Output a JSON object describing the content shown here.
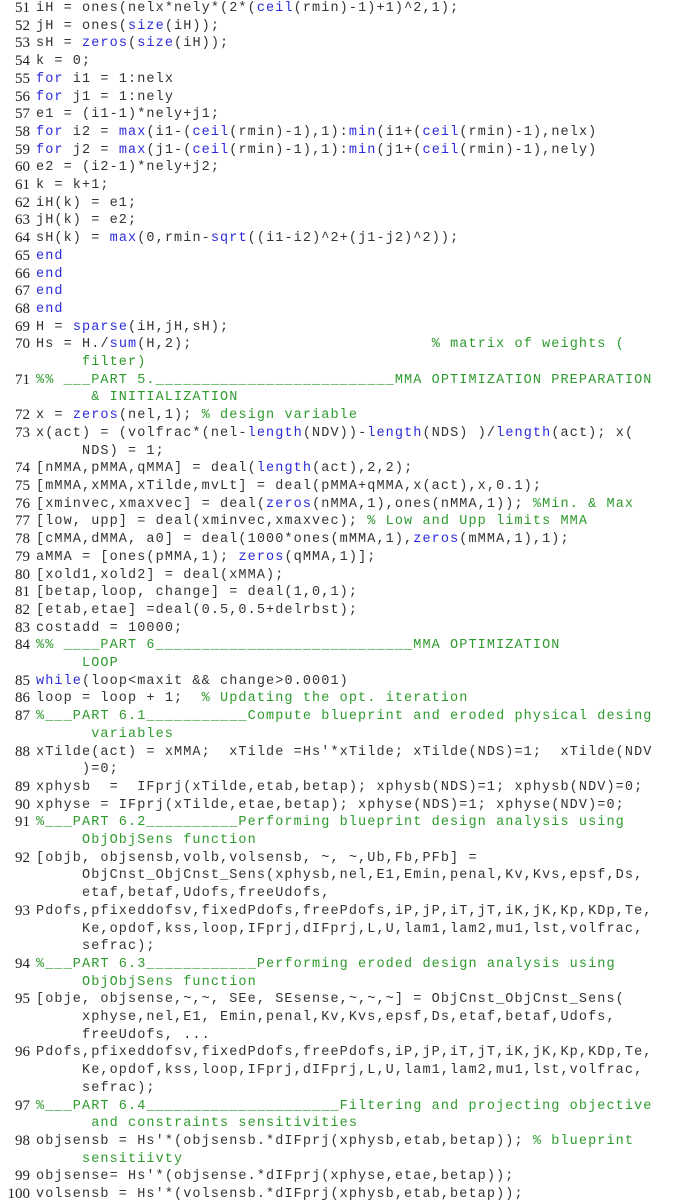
{
  "colors": {
    "keyword": "#2b2bdb",
    "comment": "#2e9a2e",
    "text": "#333333",
    "line_number": "#222222"
  },
  "lines": [
    {
      "n": "51",
      "segs": [
        [
          "t",
          "iH = ones(nelx*nely*(2*("
        ],
        [
          "k",
          "ceil"
        ],
        [
          "t",
          "(rmin)-1)+1)^2,1);"
        ]
      ]
    },
    {
      "n": "52",
      "segs": [
        [
          "t",
          "jH = ones("
        ],
        [
          "k",
          "size"
        ],
        [
          "t",
          "(iH));"
        ]
      ]
    },
    {
      "n": "53",
      "segs": [
        [
          "t",
          "sH = "
        ],
        [
          "k",
          "zeros"
        ],
        [
          "t",
          "("
        ],
        [
          "k",
          "size"
        ],
        [
          "t",
          "(iH));"
        ]
      ]
    },
    {
      "n": "54",
      "segs": [
        [
          "t",
          "k = 0;"
        ]
      ]
    },
    {
      "n": "55",
      "segs": [
        [
          "k",
          "for"
        ],
        [
          "t",
          " i1 = 1:nelx"
        ]
      ]
    },
    {
      "n": "56",
      "segs": [
        [
          "k",
          "for"
        ],
        [
          "t",
          " j1 = 1:nely"
        ]
      ]
    },
    {
      "n": "57",
      "segs": [
        [
          "t",
          "e1 = (i1-1)*nely+j1;"
        ]
      ]
    },
    {
      "n": "58",
      "segs": [
        [
          "k",
          "for"
        ],
        [
          "t",
          " i2 = "
        ],
        [
          "k",
          "max"
        ],
        [
          "t",
          "(i1-("
        ],
        [
          "k",
          "ceil"
        ],
        [
          "t",
          "(rmin)-1),1):"
        ],
        [
          "k",
          "min"
        ],
        [
          "t",
          "(i1+("
        ],
        [
          "k",
          "ceil"
        ],
        [
          "t",
          "(rmin)-1),nelx)"
        ]
      ]
    },
    {
      "n": "59",
      "segs": [
        [
          "k",
          "for"
        ],
        [
          "t",
          " j2 = "
        ],
        [
          "k",
          "max"
        ],
        [
          "t",
          "(j1-("
        ],
        [
          "k",
          "ceil"
        ],
        [
          "t",
          "(rmin)-1),1):"
        ],
        [
          "k",
          "min"
        ],
        [
          "t",
          "(j1+("
        ],
        [
          "k",
          "ceil"
        ],
        [
          "t",
          "(rmin)-1),nely)"
        ]
      ]
    },
    {
      "n": "60",
      "segs": [
        [
          "t",
          "e2 = (i2-1)*nely+j2;"
        ]
      ]
    },
    {
      "n": "61",
      "segs": [
        [
          "t",
          "k = k+1;"
        ]
      ]
    },
    {
      "n": "62",
      "segs": [
        [
          "t",
          "iH(k) = e1;"
        ]
      ]
    },
    {
      "n": "63",
      "segs": [
        [
          "t",
          "jH(k) = e2;"
        ]
      ]
    },
    {
      "n": "64",
      "segs": [
        [
          "t",
          "sH(k) = "
        ],
        [
          "k",
          "max"
        ],
        [
          "t",
          "(0,rmin-"
        ],
        [
          "k",
          "sqrt"
        ],
        [
          "t",
          "((i1-i2)^2+(j1-j2)^2));"
        ]
      ]
    },
    {
      "n": "65",
      "segs": [
        [
          "k",
          "end"
        ]
      ]
    },
    {
      "n": "66",
      "segs": [
        [
          "k",
          "end"
        ]
      ]
    },
    {
      "n": "67",
      "segs": [
        [
          "k",
          "end"
        ]
      ]
    },
    {
      "n": "68",
      "segs": [
        [
          "k",
          "end"
        ]
      ]
    },
    {
      "n": "69",
      "segs": [
        [
          "t",
          "H = "
        ],
        [
          "k",
          "sparse"
        ],
        [
          "t",
          "(iH,jH,sH);"
        ]
      ]
    },
    {
      "n": "70",
      "segs": [
        [
          "t",
          "Hs = H./"
        ],
        [
          "k",
          "sum"
        ],
        [
          "t",
          "(H,2);                          "
        ],
        [
          "c",
          "% matrix of weights ("
        ]
      ]
    },
    {
      "n": "",
      "segs": [
        [
          "c",
          "filter)"
        ]
      ]
    },
    {
      "n": "71",
      "segs": [
        [
          "c",
          "%% ___PART 5.__________________________MMA OPTIMIZATION PREPARATION"
        ]
      ]
    },
    {
      "n": "",
      "segs": [
        [
          "c",
          " & INITIALIZATION"
        ]
      ]
    },
    {
      "n": "72",
      "segs": [
        [
          "t",
          "x = "
        ],
        [
          "k",
          "zeros"
        ],
        [
          "t",
          "(nel,1); "
        ],
        [
          "c",
          "% design variable"
        ]
      ]
    },
    {
      "n": "73",
      "segs": [
        [
          "t",
          "x(act) = (volfrac*(nel-"
        ],
        [
          "k",
          "length"
        ],
        [
          "t",
          "(NDV))-"
        ],
        [
          "k",
          "length"
        ],
        [
          "t",
          "(NDS) )/"
        ],
        [
          "k",
          "length"
        ],
        [
          "t",
          "(act); x("
        ]
      ]
    },
    {
      "n": "",
      "segs": [
        [
          "t",
          "NDS) = 1;"
        ]
      ]
    },
    {
      "n": "74",
      "segs": [
        [
          "t",
          "[nMMA,pMMA,qMMA] = deal("
        ],
        [
          "k",
          "length"
        ],
        [
          "t",
          "(act),2,2);"
        ]
      ]
    },
    {
      "n": "75",
      "segs": [
        [
          "t",
          "[mMMA,xMMA,xTilde,mvLt] = deal(pMMA+qMMA,x(act),x,0.1);"
        ]
      ]
    },
    {
      "n": "76",
      "segs": [
        [
          "t",
          "[xminvec,xmaxvec] = deal("
        ],
        [
          "k",
          "zeros"
        ],
        [
          "t",
          "(nMMA,1),ones(nMMA,1)); "
        ],
        [
          "c",
          "%Min. & Max"
        ]
      ]
    },
    {
      "n": "77",
      "segs": [
        [
          "t",
          "[low, upp] = deal(xminvec,xmaxvec); "
        ],
        [
          "c",
          "% Low and Upp limits MMA"
        ]
      ]
    },
    {
      "n": "78",
      "segs": [
        [
          "t",
          "[cMMA,dMMA, a0] = deal(1000*ones(mMMA,1),"
        ],
        [
          "k",
          "zeros"
        ],
        [
          "t",
          "(mMMA,1),1);"
        ]
      ]
    },
    {
      "n": "79",
      "segs": [
        [
          "t",
          "aMMA = [ones(pMMA,1); "
        ],
        [
          "k",
          "zeros"
        ],
        [
          "t",
          "(qMMA,1)];"
        ]
      ]
    },
    {
      "n": "80",
      "segs": [
        [
          "t",
          "[xold1,xold2] = deal(xMMA);"
        ]
      ]
    },
    {
      "n": "81",
      "segs": [
        [
          "t",
          "[betap,loop, change] = deal(1,0,1);"
        ]
      ]
    },
    {
      "n": "82",
      "segs": [
        [
          "t",
          "[etab,etae] =deal(0.5,0.5+delrbst);"
        ]
      ]
    },
    {
      "n": "83",
      "segs": [
        [
          "t",
          "costadd = 10000;"
        ]
      ]
    },
    {
      "n": "84",
      "segs": [
        [
          "c",
          "%% ____PART 6____________________________MMA OPTIMIZATION"
        ]
      ]
    },
    {
      "n": "",
      "segs": [
        [
          "c",
          "LOOP"
        ]
      ]
    },
    {
      "n": "85",
      "segs": [
        [
          "k",
          "while"
        ],
        [
          "t",
          "(loop<maxit && change>0.0001)"
        ]
      ]
    },
    {
      "n": "86",
      "segs": [
        [
          "t",
          "loop = loop + 1;  "
        ],
        [
          "c",
          "% Updating the opt. iteration"
        ]
      ]
    },
    {
      "n": "87",
      "segs": [
        [
          "c",
          "%___PART 6.1___________Compute blueprint and eroded physical desing"
        ]
      ]
    },
    {
      "n": "",
      "segs": [
        [
          "c",
          " variables"
        ]
      ]
    },
    {
      "n": "88",
      "segs": [
        [
          "t",
          "xTilde(act) = xMMA;  xTilde =Hs'*xTilde; xTilde(NDS)=1;  xTilde(NDV"
        ]
      ]
    },
    {
      "n": "",
      "segs": [
        [
          "t",
          ")=0;"
        ]
      ]
    },
    {
      "n": "89",
      "segs": [
        [
          "t",
          "xphysb  =  IFprj(xTilde,etab,betap); xphysb(NDS)=1; xphysb(NDV)=0;"
        ]
      ]
    },
    {
      "n": "90",
      "segs": [
        [
          "t",
          "xphyse = IFprj(xTilde,etae,betap); xphyse(NDS)=1; xphyse(NDV)=0;"
        ]
      ]
    },
    {
      "n": "91",
      "segs": [
        [
          "c",
          "%___PART 6.2__________Performing blueprint design analysis using"
        ]
      ]
    },
    {
      "n": "",
      "segs": [
        [
          "c",
          "ObjObjSens function"
        ]
      ]
    },
    {
      "n": "92",
      "segs": [
        [
          "t",
          "[objb, objsensb,volb,volsensb, ~, ~,Ub,Fb,PFb] ="
        ]
      ]
    },
    {
      "n": "",
      "segs": [
        [
          "t",
          "ObjCnst_ObjCnst_Sens(xphysb,nel,E1,Emin,penal,Kv,Kvs,epsf,Ds,"
        ]
      ]
    },
    {
      "n": "",
      "segs": [
        [
          "t",
          "etaf,betaf,Udofs,freeUdofs,"
        ]
      ]
    },
    {
      "n": "93",
      "segs": [
        [
          "t",
          "Pdofs,pfixeddofsv,fixedPdofs,freePdofs,iP,jP,iT,jT,iK,jK,Kp,KDp,Te,"
        ]
      ]
    },
    {
      "n": "",
      "segs": [
        [
          "t",
          "Ke,opdof,kss,loop,IFprj,dIFprj,L,U,lam1,lam2,mu1,lst,volfrac,"
        ]
      ]
    },
    {
      "n": "",
      "segs": [
        [
          "t",
          "sefrac);"
        ]
      ]
    },
    {
      "n": "94",
      "segs": [
        [
          "c",
          "%___PART 6.3____________Performing eroded design analysis using"
        ]
      ]
    },
    {
      "n": "",
      "segs": [
        [
          "c",
          "ObjObjSens function"
        ]
      ]
    },
    {
      "n": "95",
      "segs": [
        [
          "t",
          "[obje, objsense,~,~, SEe, SEsense,~,~,~] = ObjCnst_ObjCnst_Sens("
        ]
      ]
    },
    {
      "n": "",
      "segs": [
        [
          "t",
          "xphyse,nel,E1, Emin,penal,Kv,Kvs,epsf,Ds,etaf,betaf,Udofs,"
        ]
      ]
    },
    {
      "n": "",
      "segs": [
        [
          "t",
          "freeUdofs, ..."
        ]
      ]
    },
    {
      "n": "96",
      "segs": [
        [
          "t",
          "Pdofs,pfixeddofsv,fixedPdofs,freePdofs,iP,jP,iT,jT,iK,jK,Kp,KDp,Te,"
        ]
      ]
    },
    {
      "n": "",
      "segs": [
        [
          "t",
          "Ke,opdof,kss,loop,IFprj,dIFprj,L,U,lam1,lam2,mu1,lst,volfrac,"
        ]
      ]
    },
    {
      "n": "",
      "segs": [
        [
          "t",
          "sefrac);"
        ]
      ]
    },
    {
      "n": "97",
      "segs": [
        [
          "c",
          "%___PART 6.4_____________________Filtering and projecting objective"
        ]
      ]
    },
    {
      "n": "",
      "segs": [
        [
          "c",
          " and constraints sensitivities"
        ]
      ]
    },
    {
      "n": "98",
      "segs": [
        [
          "t",
          "objsensb = Hs'*(objsensb.*dIFprj(xphysb,etab,betap)); "
        ],
        [
          "c",
          "% blueprint"
        ]
      ]
    },
    {
      "n": "",
      "segs": [
        [
          "c",
          "sensitiivty"
        ]
      ]
    },
    {
      "n": "99",
      "segs": [
        [
          "t",
          "objsense= Hs'*(objsense.*dIFprj(xphyse,etae,betap));"
        ]
      ]
    },
    {
      "n": "100",
      "segs": [
        [
          "t",
          "volsensb = Hs'*(volsensb.*dIFprj(xphysb,etab,betap));"
        ]
      ]
    }
  ]
}
